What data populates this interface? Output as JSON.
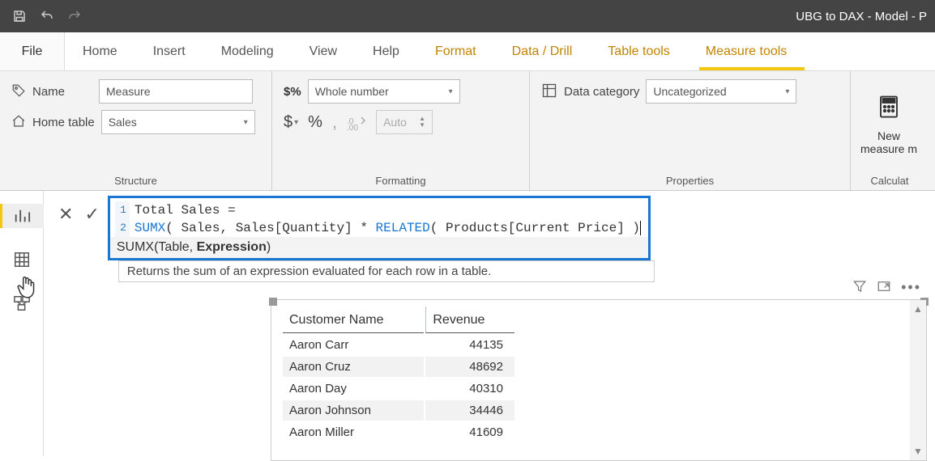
{
  "titlebar": {
    "window_title": "UBG to DAX - Model - P"
  },
  "menu": {
    "file": "File",
    "items": [
      "Home",
      "Insert",
      "Modeling",
      "View",
      "Help",
      "Format",
      "Data / Drill",
      "Table tools",
      "Measure tools"
    ],
    "accent_from": 5,
    "active_index": 8
  },
  "ribbon": {
    "structure": {
      "group_label": "Structure",
      "name_label": "Name",
      "name_value": "Measure",
      "home_table_label": "Home table",
      "home_table_value": "Sales"
    },
    "formatting": {
      "group_label": "Formatting",
      "format_value": "Whole number",
      "auto_placeholder": "Auto",
      "currency_glyph": "$",
      "percent_glyph": "%",
      "comma_glyph": ",",
      "dec_glyph": ".00"
    },
    "properties": {
      "group_label": "Properties",
      "data_cat_label": "Data category",
      "data_cat_value": "Uncategorized"
    },
    "calculations": {
      "group_label": "Calculat",
      "new_measure_line1": "New",
      "new_measure_line2": "measure  m"
    }
  },
  "formula": {
    "line1": "Total Sales =",
    "line2_sumx": "SUMX",
    "line2_mid": "( Sales, Sales[Quantity] * ",
    "line2_related": "RELATED",
    "line2_end": "( Products[Current Price] )",
    "hint_sig_pre": "SUMX(Table, ",
    "hint_sig_bold": "Expression",
    "hint_sig_post": ")",
    "hint_desc": "Returns the sum of an expression evaluated for each row in a table."
  },
  "table": {
    "col1": "Customer Name",
    "col2": "Revenue",
    "rows": [
      {
        "name": "Aaron Carr",
        "rev": "44135"
      },
      {
        "name": "Aaron Cruz",
        "rev": "48692"
      },
      {
        "name": "Aaron Day",
        "rev": "40310"
      },
      {
        "name": "Aaron Johnson",
        "rev": "34446"
      },
      {
        "name": "Aaron Miller",
        "rev": "41609"
      }
    ]
  }
}
